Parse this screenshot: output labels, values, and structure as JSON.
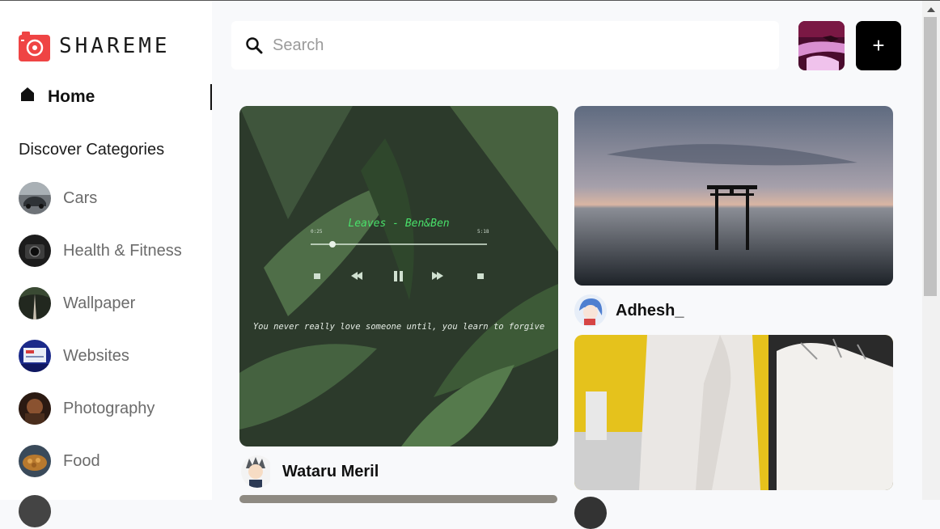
{
  "app": {
    "brand": "SHAREME"
  },
  "sidebar": {
    "home_label": "Home",
    "discover_label": "Discover Categories",
    "categories": [
      {
        "label": "Cars"
      },
      {
        "label": "Health & Fitness"
      },
      {
        "label": "Wallpaper"
      },
      {
        "label": "Websites"
      },
      {
        "label": "Photography"
      },
      {
        "label": "Food"
      }
    ]
  },
  "header": {
    "search_placeholder": "Search",
    "search_value": "",
    "add_button_label": "+"
  },
  "pins": [
    {
      "author": "Wataru Meril",
      "image_text": {
        "song_title": "Leaves - Ben&Ben",
        "time_elapsed": "0:25",
        "time_total": "5:18",
        "quote": "You never really love someone until, you learn to forgive"
      }
    },
    {
      "author": "Adhesh_"
    },
    {
      "author": ""
    }
  ],
  "colors": {
    "accent": "#ef4444",
    "button": "#000000",
    "sidebar_bg": "#ffffff",
    "page_bg": "#f8f9fb"
  }
}
